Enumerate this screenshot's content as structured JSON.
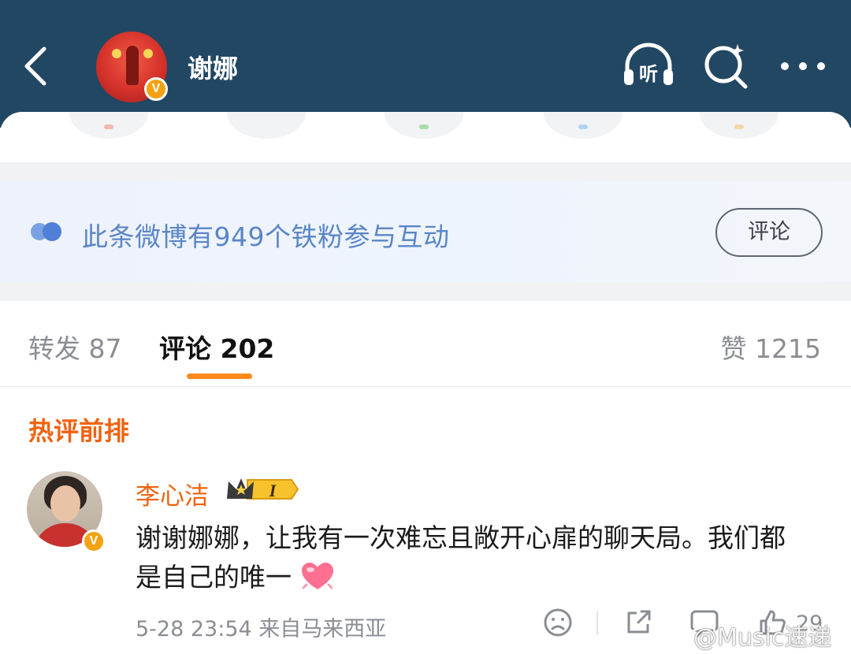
{
  "header": {
    "title": "谢娜",
    "back_icon": "chevron-left-icon",
    "listen_label": "听",
    "verified_badge": "V"
  },
  "fans_banner": {
    "text": "此条微博有949个铁粉参与互动",
    "button_label": "评论"
  },
  "tabs": {
    "repost": "转发 87",
    "comments": "评论 202",
    "likes": "赞 1215"
  },
  "section_title": "热评前排",
  "comment": {
    "author": "李心洁",
    "level_badge": "I",
    "verified_badge": "V",
    "text": "谢谢娜娜，让我有一次难忘且敞开心扉的聊天局。我们都是自己的唯一",
    "time": "5-28 23:54",
    "location": "来自马来西亚",
    "like_count": "29"
  },
  "watermark": "@Music速递",
  "colors": {
    "header_bg": "#224763",
    "accent_orange": "#f0620f",
    "tab_underline": "#ff8a1c",
    "fans_text": "#5a86c6"
  }
}
